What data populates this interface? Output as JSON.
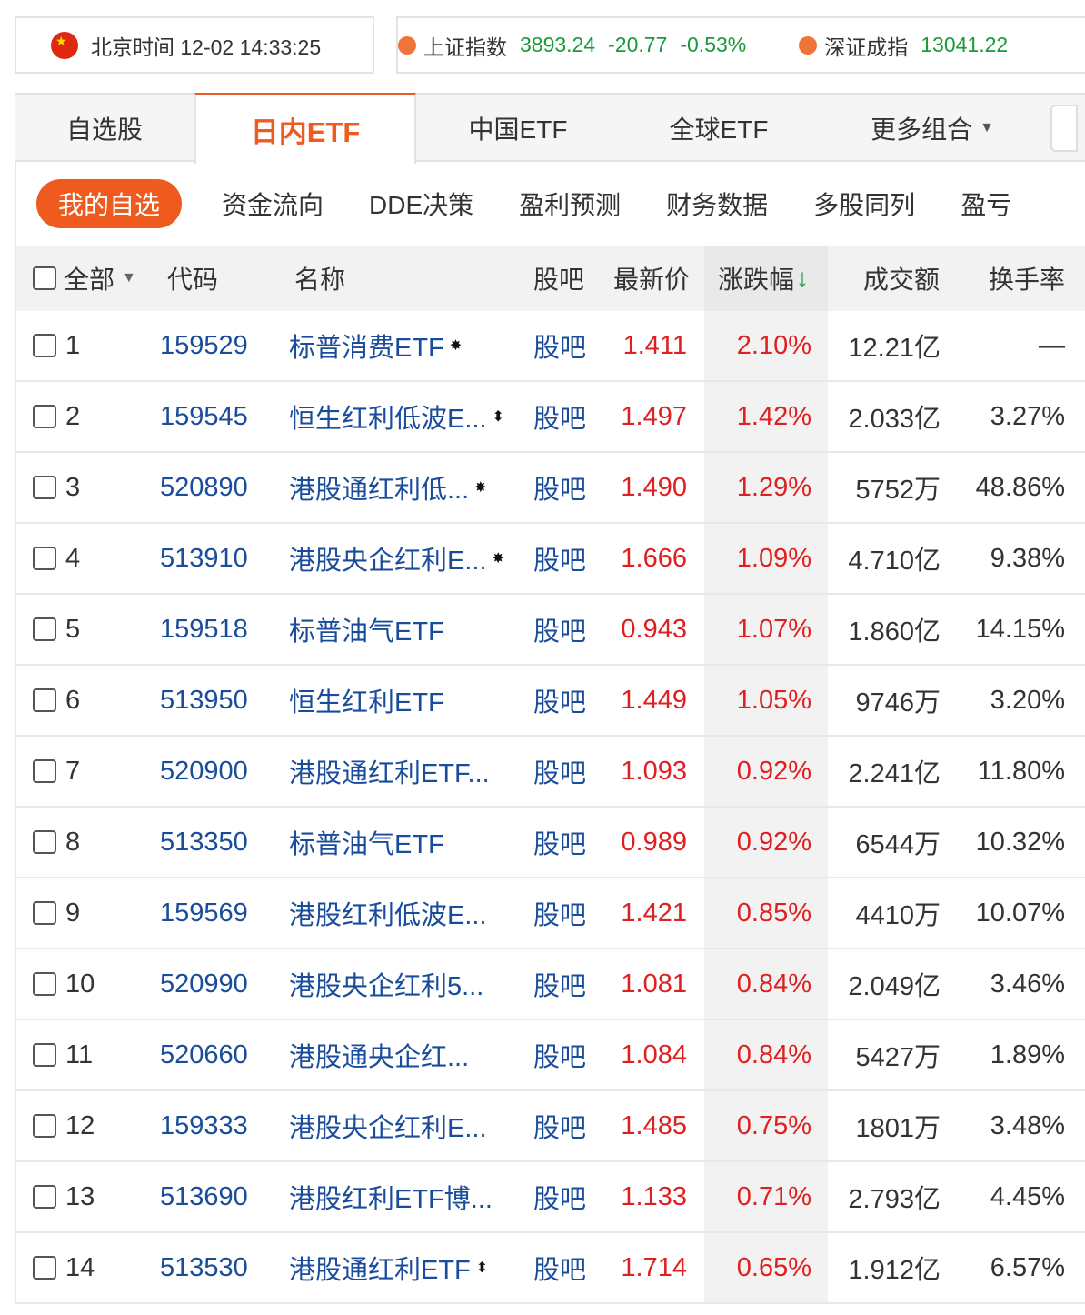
{
  "topbar": {
    "time_label": "北京时间 12-02 14:33:25",
    "indices": [
      {
        "name": "上证指数",
        "value": "3893.24",
        "change": "-20.77",
        "pct": "-0.53%"
      },
      {
        "name": "深证成指",
        "value": "13041.22",
        "change": "",
        "pct": ""
      }
    ]
  },
  "tabs": {
    "t0": "自选股",
    "t1": "日内ETF",
    "t2": "中国ETF",
    "t3": "全球ETF",
    "t4": "更多组合"
  },
  "submenu": {
    "s0": "我的自选",
    "s1": "资金流向",
    "s2": "DDE决策",
    "s3": "盈利预测",
    "s4": "财务数据",
    "s5": "多股同列",
    "s6": "盈亏"
  },
  "table": {
    "headers": {
      "all": "全部",
      "code": "代码",
      "name": "名称",
      "bar": "股吧",
      "price": "最新价",
      "change": "涨跌幅",
      "change_arrow": "↓",
      "amount": "成交额",
      "turnover": "换手率"
    },
    "rows": [
      {
        "n": "1",
        "code": "159529",
        "name": "标普消费ETF",
        "icon": "✸",
        "bar": "股吧",
        "price": "1.411",
        "chg": "2.10%",
        "amt": "12.21亿",
        "turn": "—"
      },
      {
        "n": "2",
        "code": "159545",
        "name": "恒生红利低波E...",
        "icon": "⬍",
        "bar": "股吧",
        "price": "1.497",
        "chg": "1.42%",
        "amt": "2.033亿",
        "turn": "3.27%"
      },
      {
        "n": "3",
        "code": "520890",
        "name": "港股通红利低...",
        "icon": "✸",
        "bar": "股吧",
        "price": "1.490",
        "chg": "1.29%",
        "amt": "5752万",
        "turn": "48.86%"
      },
      {
        "n": "4",
        "code": "513910",
        "name": "港股央企红利E...",
        "icon": "✸",
        "bar": "股吧",
        "price": "1.666",
        "chg": "1.09%",
        "amt": "4.710亿",
        "turn": "9.38%"
      },
      {
        "n": "5",
        "code": "159518",
        "name": "标普油气ETF",
        "icon": "",
        "bar": "股吧",
        "price": "0.943",
        "chg": "1.07%",
        "amt": "1.860亿",
        "turn": "14.15%"
      },
      {
        "n": "6",
        "code": "513950",
        "name": "恒生红利ETF",
        "icon": "",
        "bar": "股吧",
        "price": "1.449",
        "chg": "1.05%",
        "amt": "9746万",
        "turn": "3.20%"
      },
      {
        "n": "7",
        "code": "520900",
        "name": "港股通红利ETF...",
        "icon": "",
        "bar": "股吧",
        "price": "1.093",
        "chg": "0.92%",
        "amt": "2.241亿",
        "turn": "11.80%"
      },
      {
        "n": "8",
        "code": "513350",
        "name": "标普油气ETF",
        "icon": "",
        "bar": "股吧",
        "price": "0.989",
        "chg": "0.92%",
        "amt": "6544万",
        "turn": "10.32%"
      },
      {
        "n": "9",
        "code": "159569",
        "name": "港股红利低波E...",
        "icon": "",
        "bar": "股吧",
        "price": "1.421",
        "chg": "0.85%",
        "amt": "4410万",
        "turn": "10.07%"
      },
      {
        "n": "10",
        "code": "520990",
        "name": "港股央企红利5...",
        "icon": "",
        "bar": "股吧",
        "price": "1.081",
        "chg": "0.84%",
        "amt": "2.049亿",
        "turn": "3.46%"
      },
      {
        "n": "11",
        "code": "520660",
        "name": "港股通央企红...",
        "icon": "",
        "bar": "股吧",
        "price": "1.084",
        "chg": "0.84%",
        "amt": "5427万",
        "turn": "1.89%"
      },
      {
        "n": "12",
        "code": "159333",
        "name": "港股央企红利E...",
        "icon": "",
        "bar": "股吧",
        "price": "1.485",
        "chg": "0.75%",
        "amt": "1801万",
        "turn": "3.48%"
      },
      {
        "n": "13",
        "code": "513690",
        "name": "港股红利ETF博...",
        "icon": "",
        "bar": "股吧",
        "price": "1.133",
        "chg": "0.71%",
        "amt": "2.793亿",
        "turn": "4.45%"
      },
      {
        "n": "14",
        "code": "513530",
        "name": "港股通红利ETF",
        "icon": "⬍",
        "bar": "股吧",
        "price": "1.714",
        "chg": "0.65%",
        "amt": "1.912亿",
        "turn": "6.57%"
      }
    ]
  }
}
